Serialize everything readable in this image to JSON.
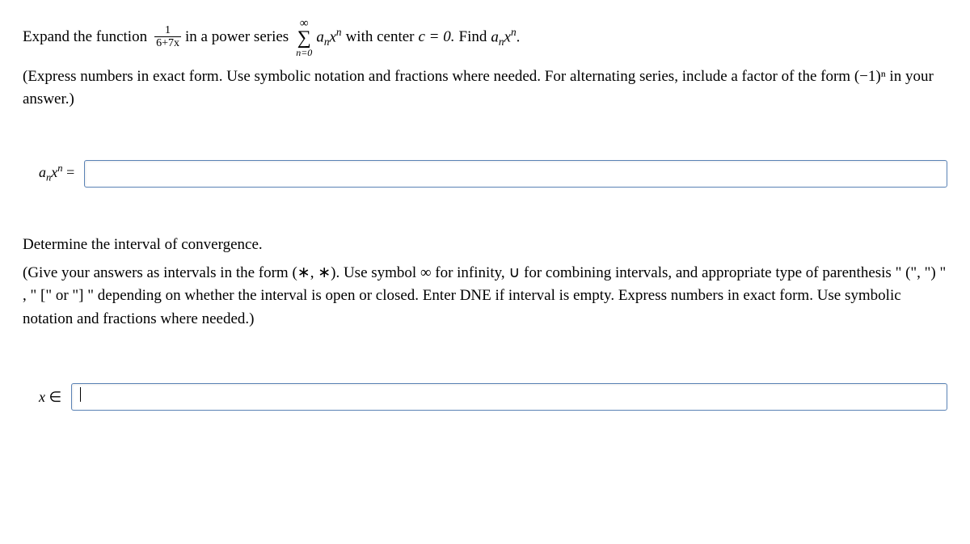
{
  "prompt": {
    "t1": "Expand the function",
    "frac_num": "1",
    "frac_den": "6+7x",
    "t2": "in a power series",
    "sum_top": "∞",
    "sum_bottom": "n=0",
    "sum_term_a": "a",
    "sum_term_sub": "n",
    "sum_term_x": "x",
    "sum_term_sup": "n",
    "t3": "with center",
    "c_eq": "c = 0.",
    "t4": "Find",
    "find_a": "a",
    "find_sub": "n",
    "find_x": "x",
    "find_sup": "n",
    "period": "."
  },
  "instr1": "(Express numbers in exact form. Use symbolic notation and fractions where needed. For alternating series, include a factor of the form (−1)ⁿ in your answer.)",
  "answer1": {
    "label_a": "a",
    "label_sub": "n",
    "label_x": "x",
    "label_sup": "n",
    "eq": " =",
    "value": ""
  },
  "q2_heading": "Determine the interval of convergence.",
  "instr2": "(Give your answers as intervals in the form (∗, ∗). Use symbol ∞ for infinity, ∪ for combining intervals, and appropriate type of parenthesis \" (\", \") \" ,  \" [\" or \"] \" depending on whether the interval is open or closed. Enter DNE if interval is empty. Express numbers in exact form. Use symbolic notation and fractions where needed.)",
  "answer2": {
    "label_x": "x",
    "in_symbol": " ∈",
    "value": ""
  }
}
